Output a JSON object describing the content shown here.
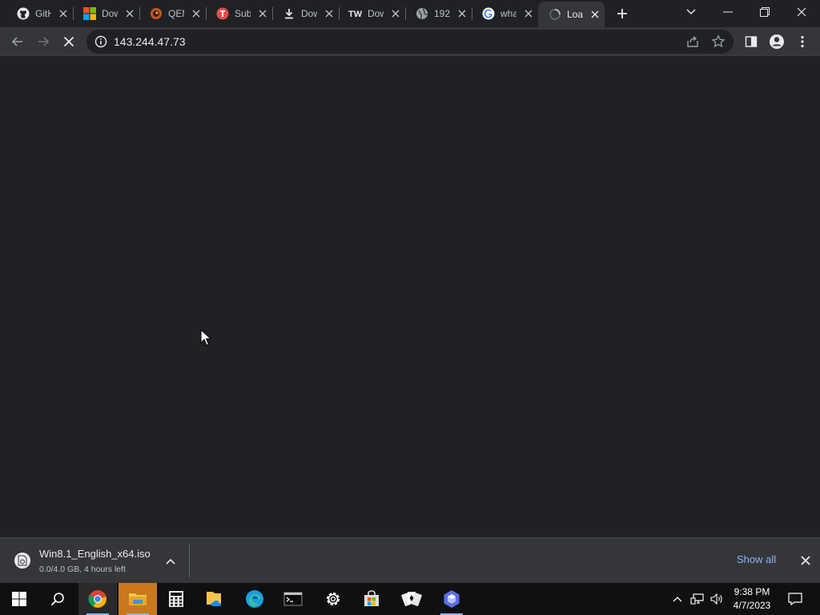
{
  "browser": {
    "tabs": [
      {
        "title": "GitHub",
        "icon": "github-icon"
      },
      {
        "title": "Download",
        "icon": "microsoft-icon"
      },
      {
        "title": "QEMU",
        "icon": "qemu-icon"
      },
      {
        "title": "Sub",
        "icon": "sub-icon"
      },
      {
        "title": "Download",
        "icon": "download-icon"
      },
      {
        "title": "Download",
        "icon": "tw-icon"
      },
      {
        "title": "192",
        "icon": "globe-icon"
      },
      {
        "title": "what",
        "icon": "google-icon"
      },
      {
        "title": "Loading",
        "icon": "loading-spinner-icon",
        "active": true
      }
    ],
    "address": {
      "url": "143.244.47.73"
    }
  },
  "download_shelf": {
    "filename": "Win8.1_English_x64.iso",
    "status": "0.0/4.0 GB, 4 hours left",
    "show_all_label": "Show all"
  },
  "taskbar": {
    "apps": [
      "start",
      "search",
      "chrome",
      "file-explorer",
      "calculator",
      "onedrive",
      "edge",
      "terminal",
      "settings",
      "store",
      "solitaire",
      "app"
    ],
    "clock": {
      "time": "9:38 PM",
      "date": "4/7/2023"
    }
  },
  "colors": {
    "accent": "#8ab4f8",
    "chrome_bg": "#202124",
    "toolbar_bg": "#35363a"
  }
}
